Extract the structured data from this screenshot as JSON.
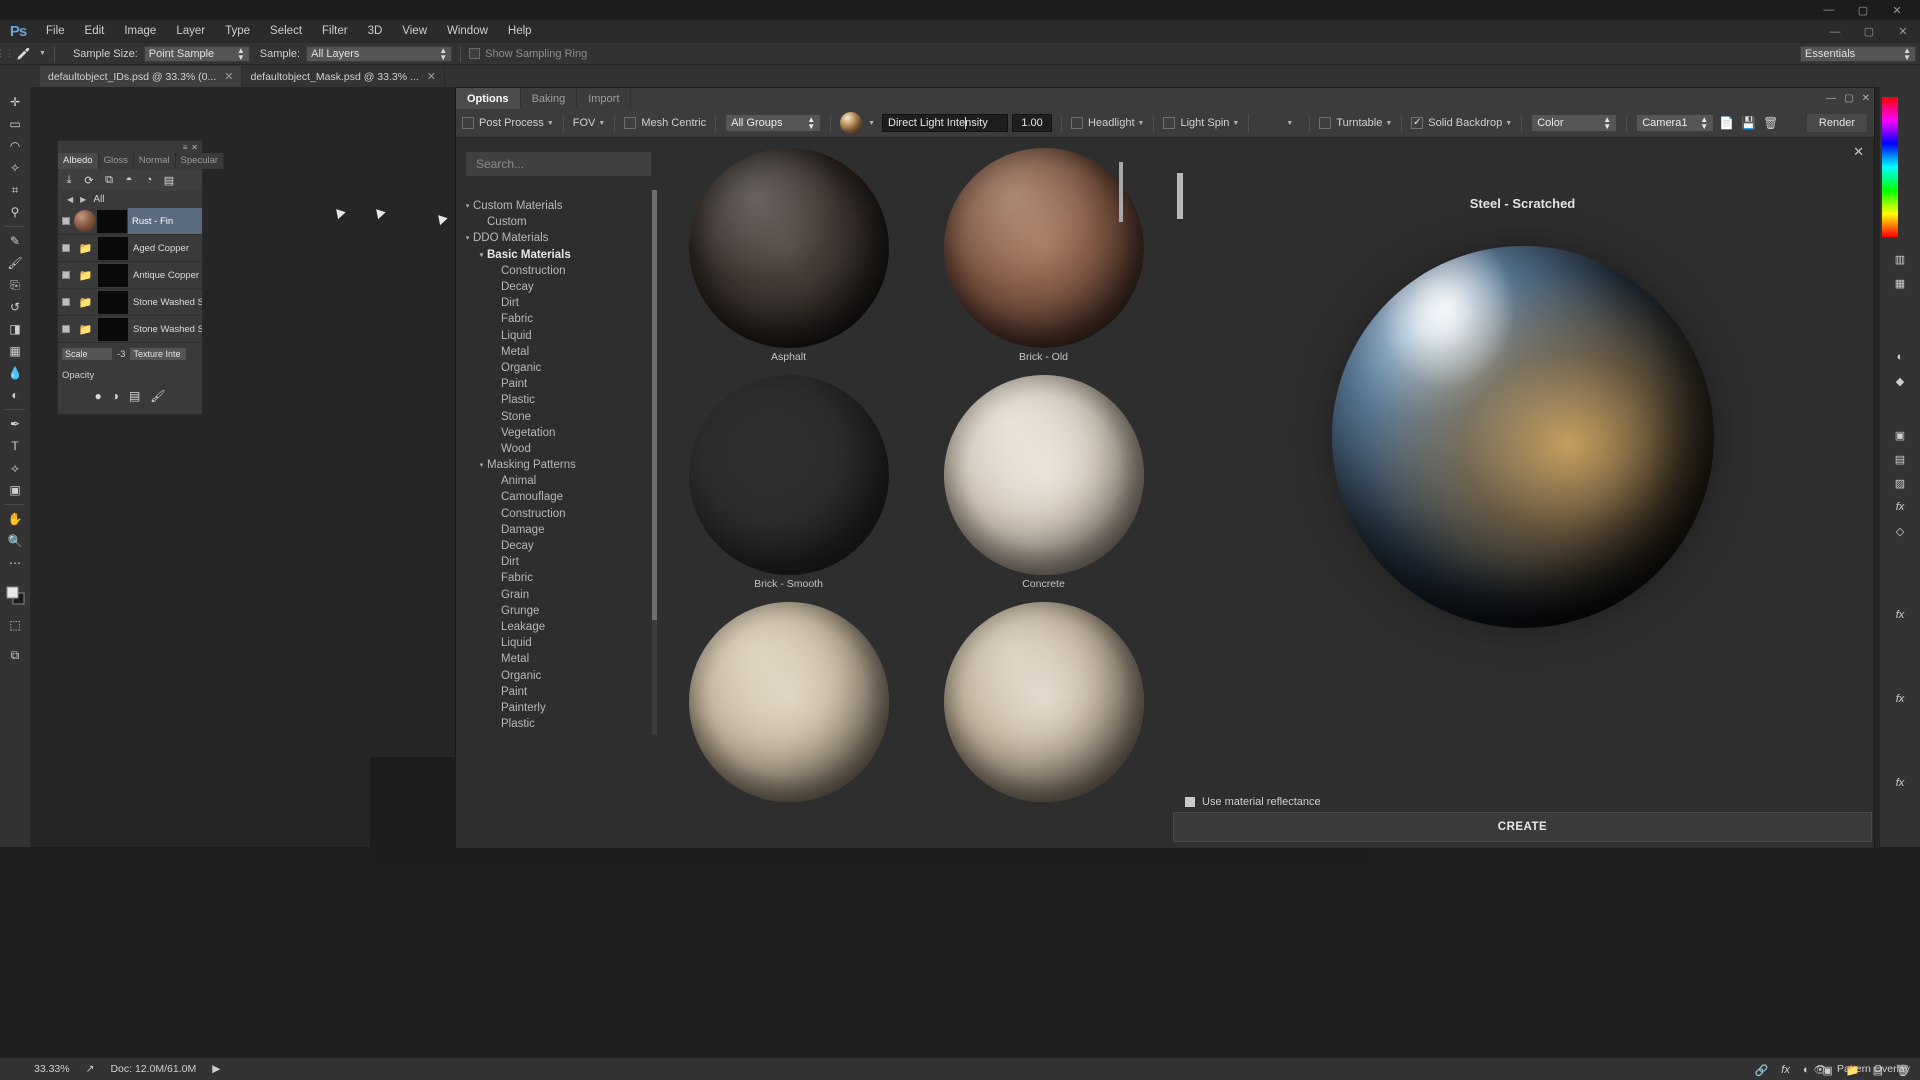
{
  "titlebar": {
    "minimize": "—",
    "maximize": "▢",
    "close": "✕"
  },
  "menubar": {
    "logo": "Ps",
    "items": [
      "File",
      "Edit",
      "Image",
      "Layer",
      "Type",
      "Select",
      "Filter",
      "3D",
      "View",
      "Window",
      "Help"
    ]
  },
  "ps_options": {
    "tool_icon": "eyedropper-icon",
    "sample_size_label": "Sample Size:",
    "sample_size_value": "Point Sample",
    "sample_label": "Sample:",
    "sample_value": "All Layers",
    "show_sampling_ring": "Show Sampling Ring",
    "workspace": "Essentials"
  },
  "doc_tabs": [
    {
      "label": "defaultobject_IDs.psd @ 33.3% (0...",
      "close": "✕",
      "active": false
    },
    {
      "label": "defaultobject_Mask.psd @ 33.3% ...",
      "close": "✕",
      "active": true
    }
  ],
  "tools": [
    "move-icon",
    "marquee-icon",
    "lasso-icon",
    "quick-select-icon",
    "crop-icon",
    "eyedropper-icon",
    "healing-icon",
    "brush-icon",
    "clone-stamp-icon",
    "history-brush-icon",
    "eraser-icon",
    "gradient-icon",
    "blur-icon",
    "dodge-icon",
    "pen-icon",
    "type-icon",
    "path-select-icon",
    "shape-icon",
    "hand-icon",
    "zoom-icon",
    "foreground-color",
    "quick-mask-icon",
    "screen-mode-icon"
  ],
  "layers_panel": {
    "tabs": [
      "Albedo",
      "Gloss",
      "Normal",
      "Specular"
    ],
    "active_tab": "Albedo",
    "toolbar_icons": [
      "import-icon",
      "refresh-icon",
      "add-group-icon",
      "add-mask-icon",
      "paint-mask-icon",
      "more-icon"
    ],
    "nav_prev": "◀",
    "nav_next": "▶",
    "nav_label": "All",
    "rows": [
      {
        "name": "Rust - Fin",
        "selected": true,
        "type": "sphere"
      },
      {
        "name": "Aged Copper",
        "selected": false,
        "type": "folder"
      },
      {
        "name": "Antique Copper",
        "selected": false,
        "type": "folder"
      },
      {
        "name": "Stone Washed S",
        "selected": false,
        "type": "folder"
      },
      {
        "name": "Stone Washed S",
        "selected": false,
        "type": "folder"
      }
    ],
    "scale_label": "Scale",
    "scale_value": "-3",
    "texture_label": "Texture Inte",
    "opacity_label": "Opacity",
    "footer_icons": [
      "circle-icon",
      "half-circle-icon",
      "page-icon",
      "brush-icon"
    ]
  },
  "ddo": {
    "tabs": [
      {
        "label": "Options",
        "active": true
      },
      {
        "label": "Baking",
        "active": false
      },
      {
        "label": "Import",
        "active": false
      }
    ],
    "window_buttons": [
      "minimize-icon",
      "maximize-icon",
      "close-icon"
    ],
    "toolbar": {
      "post_process": "Post Process",
      "post_process_checked": false,
      "fov": "FOV",
      "mesh_centric": "Mesh Centric",
      "mesh_centric_checked": false,
      "groups_value": "All Groups",
      "material_ball": "material-ball-icon",
      "light_field_value": "Direct Light Intensity",
      "light_field_number": "1.00",
      "headlight": "Headlight",
      "headlight_checked": false,
      "light_spin": "Light Spin",
      "light_spin_checked": false,
      "env_ball": "environment-ball-icon",
      "turntable": "Turntable",
      "turntable_checked": false,
      "solid_backdrop": "Solid Backdrop",
      "solid_backdrop_checked": true,
      "backdrop_mode": "Color",
      "camera": "Camera1",
      "icons": [
        "new-camera-icon",
        "save-camera-icon",
        "delete-camera-icon"
      ],
      "render": "Render"
    },
    "close_x": "✕",
    "search_placeholder": "Search...",
    "tree": [
      {
        "label": "Custom Materials",
        "depth": 0,
        "twisty": "▾",
        "bold": false
      },
      {
        "label": "Custom",
        "depth": 1,
        "twisty": "",
        "bold": false
      },
      {
        "label": "DDO Materials",
        "depth": 0,
        "twisty": "▾",
        "bold": false
      },
      {
        "label": "Basic Materials",
        "depth": 1,
        "twisty": "▾",
        "bold": true
      },
      {
        "label": "Construction",
        "depth": 2,
        "twisty": "",
        "bold": false
      },
      {
        "label": "Decay",
        "depth": 2,
        "twisty": "",
        "bold": false
      },
      {
        "label": "Dirt",
        "depth": 2,
        "twisty": "",
        "bold": false
      },
      {
        "label": "Fabric",
        "depth": 2,
        "twisty": "",
        "bold": false
      },
      {
        "label": "Liquid",
        "depth": 2,
        "twisty": "",
        "bold": false
      },
      {
        "label": "Metal",
        "depth": 2,
        "twisty": "",
        "bold": false
      },
      {
        "label": "Organic",
        "depth": 2,
        "twisty": "",
        "bold": false
      },
      {
        "label": "Paint",
        "depth": 2,
        "twisty": "",
        "bold": false
      },
      {
        "label": "Plastic",
        "depth": 2,
        "twisty": "",
        "bold": false
      },
      {
        "label": "Stone",
        "depth": 2,
        "twisty": "",
        "bold": false
      },
      {
        "label": "Vegetation",
        "depth": 2,
        "twisty": "",
        "bold": false
      },
      {
        "label": "Wood",
        "depth": 2,
        "twisty": "",
        "bold": false
      },
      {
        "label": "Masking Patterns",
        "depth": 1,
        "twisty": "▾",
        "bold": false
      },
      {
        "label": "Animal",
        "depth": 2,
        "twisty": "",
        "bold": false
      },
      {
        "label": "Camouflage",
        "depth": 2,
        "twisty": "",
        "bold": false
      },
      {
        "label": "Construction",
        "depth": 2,
        "twisty": "",
        "bold": false
      },
      {
        "label": "Damage",
        "depth": 2,
        "twisty": "",
        "bold": false
      },
      {
        "label": "Decay",
        "depth": 2,
        "twisty": "",
        "bold": false
      },
      {
        "label": "Dirt",
        "depth": 2,
        "twisty": "",
        "bold": false
      },
      {
        "label": "Fabric",
        "depth": 2,
        "twisty": "",
        "bold": false
      },
      {
        "label": "Grain",
        "depth": 2,
        "twisty": "",
        "bold": false
      },
      {
        "label": "Grunge",
        "depth": 2,
        "twisty": "",
        "bold": false
      },
      {
        "label": "Leakage",
        "depth": 2,
        "twisty": "",
        "bold": false
      },
      {
        "label": "Liquid",
        "depth": 2,
        "twisty": "",
        "bold": false
      },
      {
        "label": "Metal",
        "depth": 2,
        "twisty": "",
        "bold": false
      },
      {
        "label": "Organic",
        "depth": 2,
        "twisty": "",
        "bold": false
      },
      {
        "label": "Paint",
        "depth": 2,
        "twisty": "",
        "bold": false
      },
      {
        "label": "Painterly",
        "depth": 2,
        "twisty": "",
        "bold": false
      },
      {
        "label": "Plastic",
        "depth": 2,
        "twisty": "",
        "bold": false
      }
    ],
    "materials": [
      {
        "label": "Asphalt",
        "swatch": "sph-asphalt"
      },
      {
        "label": "Brick - Old",
        "swatch": "sph-brickold"
      },
      {
        "label": "Brick - Smooth",
        "swatch": "sph-bricksmooth"
      },
      {
        "label": "Concrete",
        "swatch": "sph-concrete"
      },
      {
        "label": "",
        "swatch": "sph-sand"
      },
      {
        "label": "",
        "swatch": "sph-crack"
      }
    ],
    "preview": {
      "title": "Steel - Scratched",
      "use_reflectance": "Use material reflectance",
      "use_reflectance_checked": true,
      "create": "CREATE"
    }
  },
  "statusbar": {
    "zoom": "33.33%",
    "doc": "Doc: 12.0M/61.0M",
    "arrow": "▶",
    "right_label": "Pattern Overlay",
    "right_icons": [
      "link-icon",
      "fx-icon",
      "adjust-icon",
      "mask-icon",
      "group-icon",
      "new-layer-icon",
      "trash-icon"
    ]
  }
}
